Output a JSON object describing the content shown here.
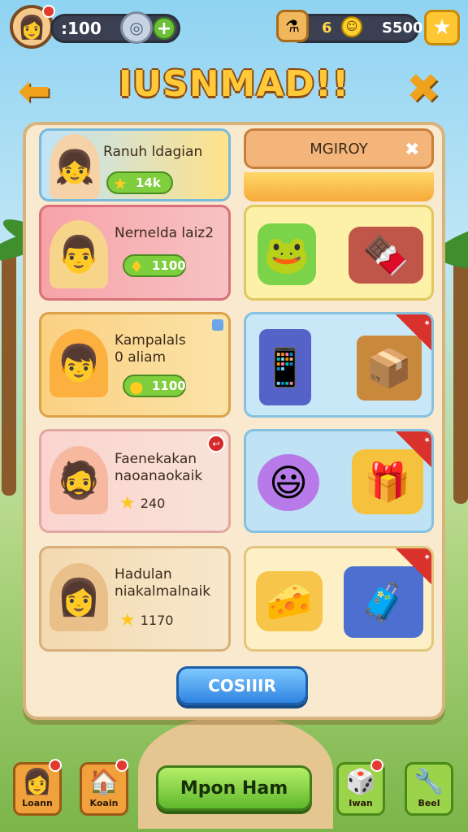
{
  "topbar": {
    "coins": ":100",
    "gems": "6",
    "coins2": "S500"
  },
  "title": "IUSNMAD!!",
  "merchant": {
    "label": "MGIROY"
  },
  "left_cards": [
    {
      "name": "Ranuh ldagian",
      "reward": "14k",
      "reward_style": "pill"
    },
    {
      "name": "Nernelda laiz2",
      "reward": "1100",
      "reward_style": "pill"
    },
    {
      "name": "Kampalals\n0 aliam",
      "reward": "1100",
      "reward_style": "pill"
    },
    {
      "name": "Faenekakan\nnaoanaokaik",
      "reward": "240",
      "reward_style": "plain",
      "badge": "↩"
    },
    {
      "name": "Hadulan\nniakalmalnaik",
      "reward": "1170",
      "reward_style": "plain"
    }
  ],
  "right_cards": [
    {
      "items": [
        "slime",
        "chocolate-bar"
      ]
    },
    {
      "items": [
        "phone",
        "treasure-chest"
      ],
      "ribbon": "★"
    },
    {
      "items": [
        "smiley-blob",
        "gift-camera"
      ],
      "ribbon": "★"
    },
    {
      "items": [
        "cheese-bag",
        "suitcase"
      ],
      "ribbon": "★"
    }
  ],
  "continue_label": "COSIIIR",
  "bottom_nav": {
    "b1": "Loann",
    "b2": "Koain",
    "play": "Mpon Ham",
    "b4": "Iwan",
    "b5": "Beel"
  }
}
